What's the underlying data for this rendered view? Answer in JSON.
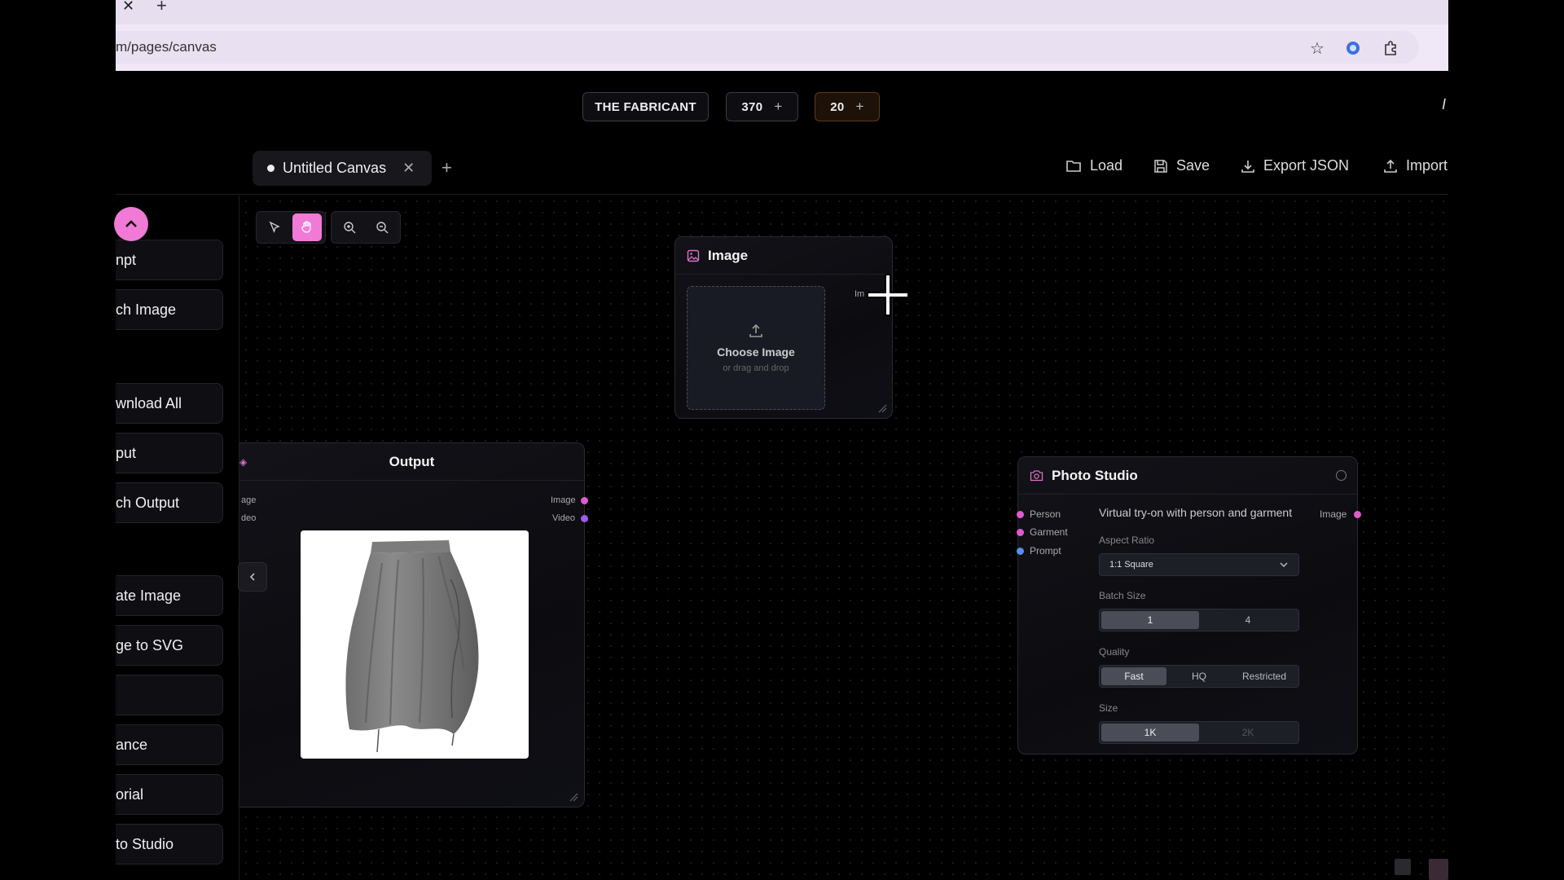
{
  "browser": {
    "url": "m/pages/canvas",
    "tab_close": "✕",
    "new_tab": "+"
  },
  "header": {
    "brand": "THE FABRICANT",
    "credits_primary": "370",
    "credits_secondary": "20",
    "plus": "+"
  },
  "canvas_tabs": {
    "active_tab": "Untitled Canvas",
    "close": "✕",
    "add": "+"
  },
  "actions": {
    "load": "Load",
    "save": "Save",
    "export": "Export JSON",
    "import": "Import"
  },
  "sidebar": {
    "items": [
      {
        "label": "npt"
      },
      {
        "label": "ch Image"
      },
      {
        "label": "wnload All"
      },
      {
        "label": "put"
      },
      {
        "label": "ch Output"
      },
      {
        "label": "ate Image"
      },
      {
        "label": "ge to SVG"
      },
      {
        "label": ""
      },
      {
        "label": "ance"
      },
      {
        "label": "orial"
      },
      {
        "label": "to Studio"
      }
    ]
  },
  "image_node": {
    "title": "Image",
    "choose": "Choose Image",
    "drag": "or drag and drop",
    "port_label": "Im"
  },
  "output_node": {
    "title": "Output",
    "in_image": "age",
    "in_video": "deo",
    "out_image": "Image",
    "out_video": "Video",
    "preview_alt": "grey gathered skirt"
  },
  "studio_node": {
    "title": "Photo Studio",
    "description": "Virtual try-on with person and garment",
    "inputs": [
      "Person",
      "Garment",
      "Prompt"
    ],
    "output": "Image",
    "aspect_label": "Aspect Ratio",
    "aspect_value": "1:1 Square",
    "batch_label": "Batch Size",
    "batch_options": [
      "1",
      "4"
    ],
    "quality_label": "Quality",
    "quality_options": [
      "Fast",
      "HQ",
      "Restricted"
    ],
    "size_label": "Size",
    "size_options": [
      "1K",
      "2K"
    ]
  },
  "colors": {
    "accent": "#f07ad6",
    "port_pink": "#e05ad0",
    "port_purple": "#a05af0",
    "port_blue": "#5a8cf0"
  }
}
